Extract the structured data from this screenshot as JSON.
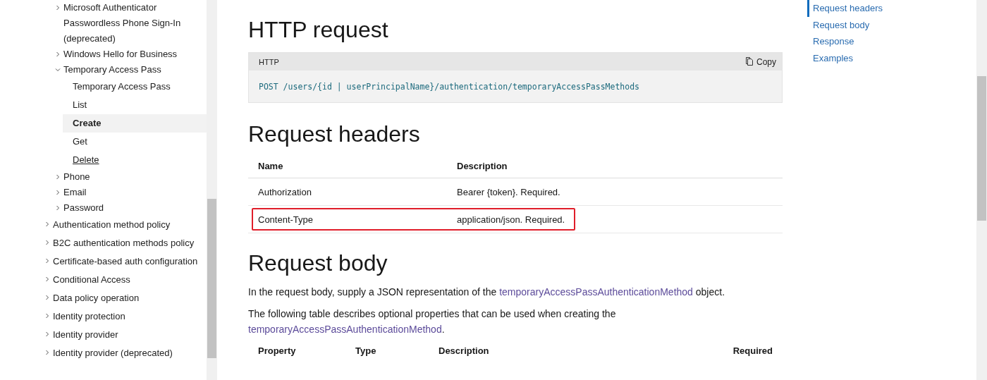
{
  "sidebar": {
    "sub_items": [
      {
        "label": "Microsoft Authenticator Passwordless Phone Sign-In (deprecated)",
        "expanded": false
      },
      {
        "label": "Windows Hello for Business",
        "expanded": false
      },
      {
        "label": "Temporary Access Pass",
        "expanded": true,
        "children": [
          {
            "label": "Temporary Access Pass",
            "selected": false,
            "hovered": false
          },
          {
            "label": "List",
            "selected": false,
            "hovered": false
          },
          {
            "label": "Create",
            "selected": true,
            "hovered": false
          },
          {
            "label": "Get",
            "selected": false,
            "hovered": false
          },
          {
            "label": "Delete",
            "selected": false,
            "hovered": true
          }
        ]
      },
      {
        "label": "Phone",
        "expanded": false
      },
      {
        "label": "Email",
        "expanded": false
      },
      {
        "label": "Password",
        "expanded": false
      }
    ],
    "items": [
      {
        "label": "Authentication method policy",
        "expanded": false
      },
      {
        "label": "B2C authentication methods policy",
        "expanded": false
      },
      {
        "label": "Certificate-based auth configuration",
        "expanded": false
      },
      {
        "label": "Conditional Access",
        "expanded": false
      },
      {
        "label": "Data policy operation",
        "expanded": false
      },
      {
        "label": "Identity protection",
        "expanded": false
      },
      {
        "label": "Identity provider",
        "expanded": false
      },
      {
        "label": "Identity provider (deprecated)",
        "expanded": false
      }
    ]
  },
  "http_request": {
    "heading": "HTTP request",
    "code_block": {
      "language": "HTTP",
      "copy": "Copy",
      "code": "POST /users/{id | userPrincipalName}/authentication/temporaryAccessPassMethods"
    }
  },
  "request_headers": {
    "heading": "Request headers",
    "table": {
      "columns": [
        "Name",
        "Description"
      ],
      "rows": [
        {
          "cells": [
            "Authorization",
            "Bearer {token}. Required."
          ],
          "highlighted": false
        },
        {
          "cells": [
            "Content-Type",
            "application/json. Required."
          ],
          "highlighted": true
        }
      ]
    }
  },
  "request_body": {
    "heading": "Request body",
    "paragraphs": [
      {
        "before": "In the request body, supply a JSON representation of the ",
        "link": "temporaryAccessPassAuthenticationMethod",
        "after": " object."
      },
      {
        "before": "The following table describes optional properties that can be used when creating the ",
        "link": "temporaryAccessPassAuthenticationMethod",
        "after": "."
      }
    ],
    "table": {
      "columns": [
        "Property",
        "Type",
        "Description",
        "Required"
      ]
    }
  },
  "toc": {
    "items": [
      {
        "label": "Request headers",
        "selected": true
      },
      {
        "label": "Request body",
        "selected": false
      },
      {
        "label": "Response",
        "selected": false
      },
      {
        "label": "Examples",
        "selected": false
      }
    ]
  }
}
